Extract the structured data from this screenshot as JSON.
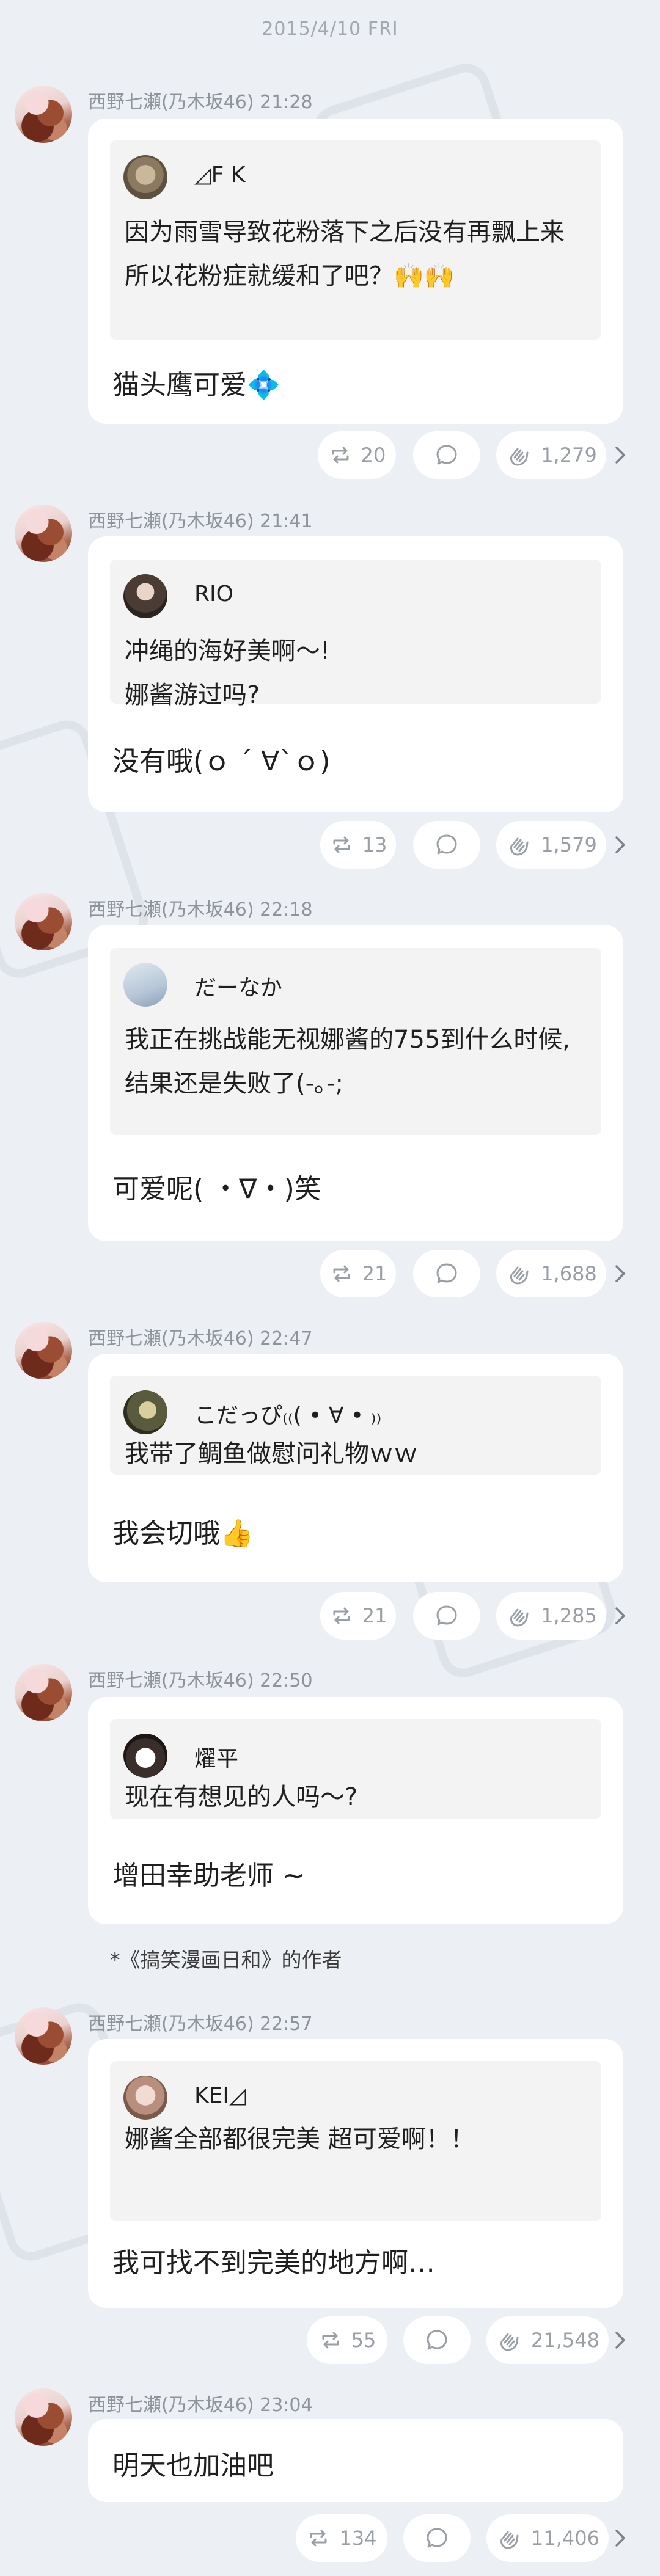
{
  "date_header": "2015/4/10 FRI",
  "messages": [
    {
      "sender": "西野七瀬(乃木坂46) 21:28",
      "quote": {
        "name": "◿F K",
        "text": "因为雨雪导致花粉落下之后没有再飘上来\n所以花粉症就缓和了吧？🙌🙌"
      },
      "reply": "猫头鹰可爱💠",
      "reposts": "20",
      "likes": "1,279"
    },
    {
      "sender": "西野七瀬(乃木坂46) 21:41",
      "quote": {
        "name": "RIO",
        "text": "冲绳的海好美啊〜!\n娜酱游过吗?"
      },
      "reply": "没有哦(ｏ ´ ∀`ｏ)",
      "reposts": "13",
      "likes": "1,579"
    },
    {
      "sender": "西野七瀬(乃木坂46) 22:18",
      "quote": {
        "name": "だーなか",
        "text": "我正在挑战能无视娜酱的755到什么时候,\n结果还是失败了(-｡-;"
      },
      "reply": "可爱呢( ・∇・)笑",
      "reposts": "21",
      "likes": "1,688"
    },
    {
      "sender": "西野七瀬(乃木坂46) 22:47",
      "quote": {
        "name": "こだっぴ₍₍( • ∀ • ₎₎",
        "text": "我带了鲷鱼做慰问礼物ｗｗ"
      },
      "reply": "我会切哦👍",
      "reposts": "21",
      "likes": "1,285"
    },
    {
      "sender": "西野七瀬(乃木坂46) 22:50",
      "quote": {
        "name": "燿平",
        "text": "现在有想见的人吗〜?"
      },
      "reply": "增田幸助老师 ~",
      "note": "*《搞笑漫画日和》的作者"
    },
    {
      "sender": "西野七瀬(乃木坂46) 22:57",
      "quote": {
        "name": "KEI◿",
        "text": "娜酱全部都很完美 超可爱啊！！"
      },
      "reply": "我可找不到完美的地方啊…",
      "reposts": "55",
      "likes": "21,548"
    },
    {
      "sender": "西野七瀬(乃木坂46) 23:04",
      "reply": "明天也加油吧",
      "reposts": "134",
      "likes": "11,406"
    }
  ],
  "colors": {
    "background": "#eceff3",
    "bubble": "#ffffff",
    "quote_box": "#f3f3f3",
    "meta_text": "#8f949b"
  },
  "icons": [
    "repost-icon",
    "comment-icon",
    "clap-icon",
    "chevron-right-icon"
  ]
}
